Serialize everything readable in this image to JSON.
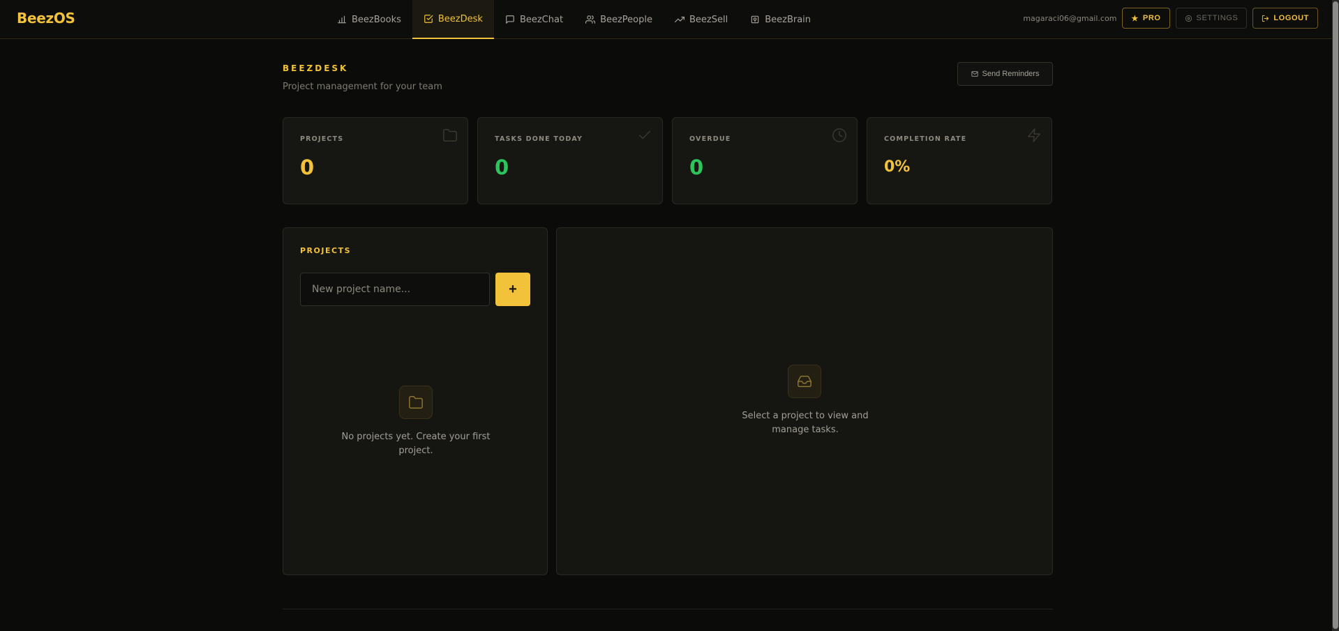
{
  "app": {
    "logo": "BeezOS"
  },
  "nav": {
    "items": [
      {
        "label": "BeezBooks",
        "icon": "bar-chart-icon"
      },
      {
        "label": "BeezDesk",
        "icon": "check-square-icon",
        "active": true
      },
      {
        "label": "BeezChat",
        "icon": "message-icon"
      },
      {
        "label": "BeezPeople",
        "icon": "users-icon"
      },
      {
        "label": "BeezSell",
        "icon": "trending-up-icon"
      },
      {
        "label": "BeezBrain",
        "icon": "brain-icon"
      }
    ]
  },
  "user": {
    "email": "magaraci06@gmail.com",
    "pro_label": "PRO",
    "settings_label": "SETTINGS",
    "logout_label": "LOGOUT"
  },
  "page": {
    "eyebrow": "BEEZDESK",
    "subtitle": "Project management for your team",
    "reminders_label": "Send Reminders"
  },
  "stats": [
    {
      "label": "PROJECTS",
      "value": "0",
      "color": "#f2c23a",
      "icon": "folder-icon"
    },
    {
      "label": "TASKS DONE TODAY",
      "value": "0",
      "color": "#2ec45c",
      "icon": "check-icon"
    },
    {
      "label": "OVERDUE",
      "value": "0",
      "color": "#2ec45c",
      "icon": "clock-icon"
    },
    {
      "label": "COMPLETION RATE",
      "value": "0%",
      "color": "#f2c23a",
      "icon": "zap-icon"
    }
  ],
  "projects_panel": {
    "title": "PROJECTS",
    "input_placeholder": "New project name...",
    "add_label": "+",
    "empty_line1": "No projects yet. Create your first",
    "empty_line2": "project."
  },
  "tasks_panel": {
    "empty_line1": "Select a project to view and",
    "empty_line2": "manage tasks."
  },
  "colors": {
    "accent": "#f2c23a",
    "success": "#2ec45c",
    "background": "#0b0b09",
    "card": "#161613"
  }
}
